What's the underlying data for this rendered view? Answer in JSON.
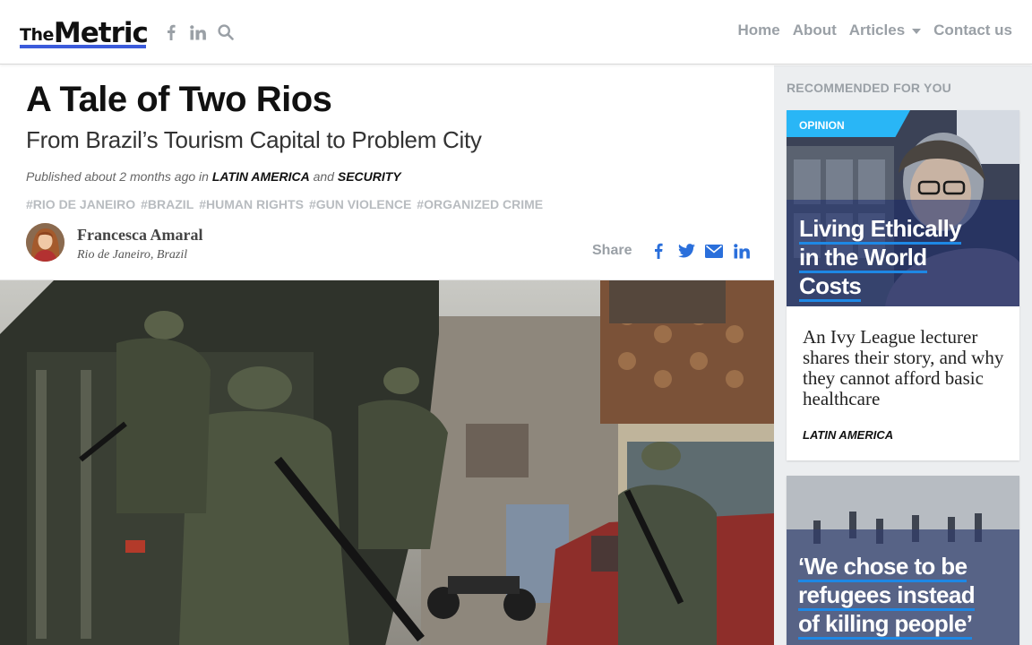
{
  "brand": {
    "the": "The",
    "metric": "Metric",
    "accent": "#3b5bdb"
  },
  "header": {
    "social": [
      "facebook-icon",
      "linkedin-icon",
      "search-icon"
    ],
    "nav": {
      "home": "Home",
      "about": "About",
      "articles": "Articles",
      "contact": "Contact us"
    }
  },
  "article": {
    "title": "A Tale of Two Rios",
    "subtitle": "From Brazil’s Tourism Capital to Problem City",
    "meta": {
      "prefix": "Published about 2 months ago in",
      "category1": "LATIN AMERICA",
      "conj": "and",
      "category2": "SECURITY"
    },
    "tags": [
      "#RIO DE JANEIRO",
      "#BRAZIL",
      "#HUMAN RIGHTS",
      "#GUN VIOLENCE",
      "#ORGANIZED CRIME"
    ],
    "author": {
      "name": "Francesca Amaral",
      "location": "Rio de Janeiro, Brazil"
    },
    "share": {
      "label": "Share",
      "icons": [
        "facebook-icon",
        "twitter-icon",
        "mail-icon",
        "linkedin-icon"
      ],
      "color": "#2a6fdb"
    }
  },
  "sidebar": {
    "heading": "RECOMMENDED FOR YOU",
    "card1": {
      "badge": "OPINION",
      "title_lines": [
        "Living Ethically",
        "in the World",
        "Costs"
      ],
      "excerpt": "An Ivy League lecturer shares their story, and why they cannot afford basic healthcare",
      "category": "LATIN AMERICA"
    },
    "card2": {
      "title_lines": [
        "‘We chose to be",
        "refugees instead",
        "of killing people’"
      ]
    }
  }
}
